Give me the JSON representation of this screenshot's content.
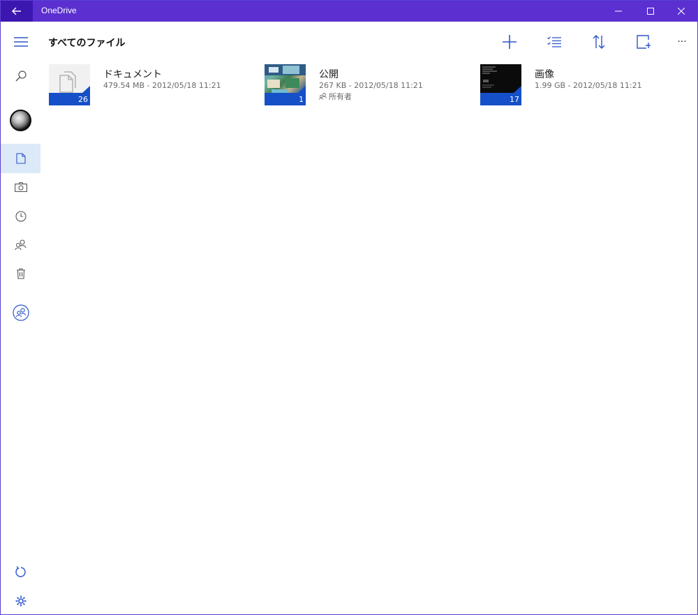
{
  "app": {
    "title": "OneDrive"
  },
  "colors": {
    "titlebar": "#5b2fd0",
    "back_button": "#3b17b0",
    "accent": "#1650c8",
    "active_nav": "#dbe9f8"
  },
  "header": {
    "title": "すべてのファイル"
  },
  "toolbar": {
    "icons": [
      "add-icon",
      "select-icon",
      "sort-icon",
      "view-icon",
      "more-icon"
    ],
    "more_label": "···"
  },
  "sidebar": {
    "icons": [
      "hamburger-icon",
      "search-icon",
      "avatar",
      "files-icon",
      "photos-icon",
      "recent-icon",
      "shared-icon",
      "recycle-bin-icon",
      "groups-icon",
      "sync-icon",
      "settings-icon"
    ]
  },
  "items": [
    {
      "name": "ドキュメント",
      "meta": "479.54 MB - 2012/05/18 11:21",
      "count": "26",
      "thumb": "document"
    },
    {
      "name": "公開",
      "meta": "267 KB - 2012/05/18 11:21",
      "count": "1",
      "thumb": "photo",
      "shared": "所有者"
    },
    {
      "name": "画像",
      "meta": "1.99 GB - 2012/05/18 11:21",
      "count": "17",
      "thumb": "dark"
    }
  ]
}
